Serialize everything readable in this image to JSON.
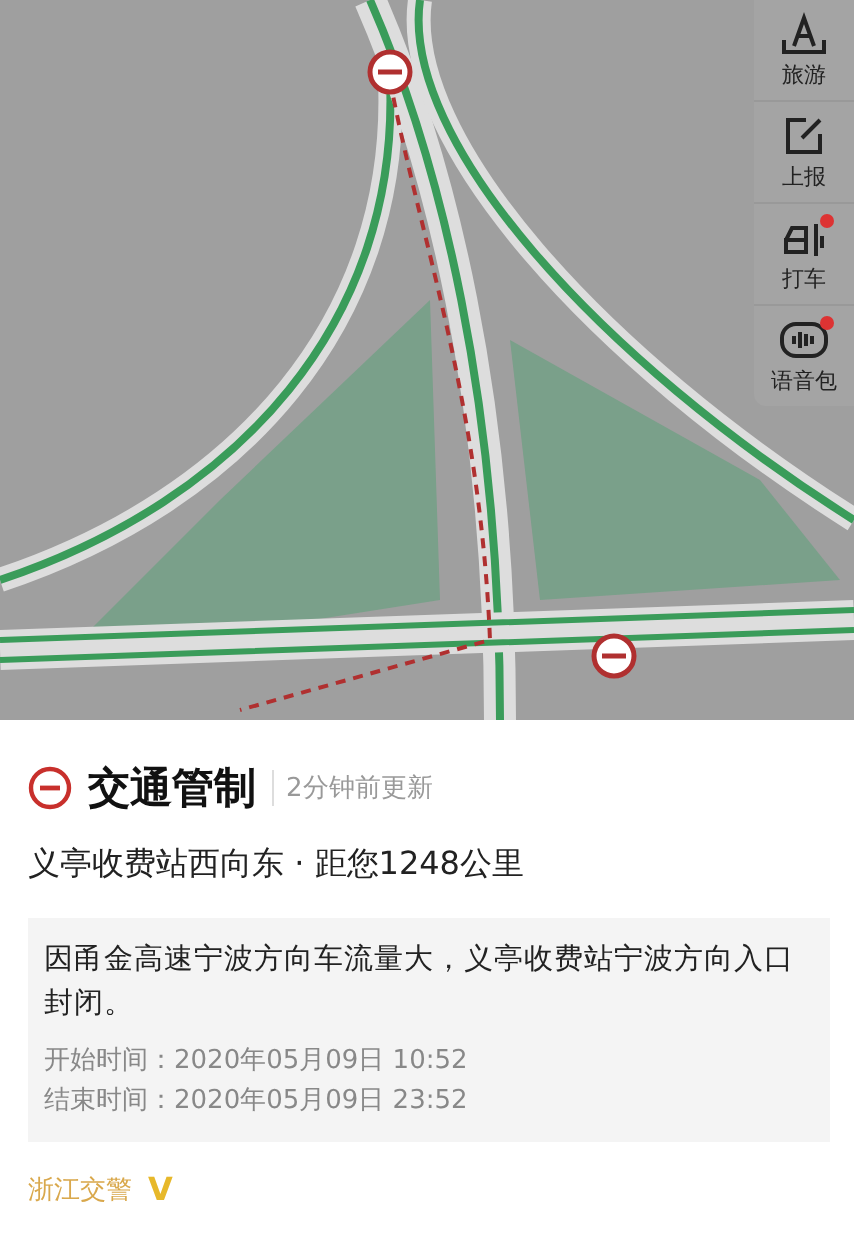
{
  "toolbar": [
    {
      "kind": "travel",
      "label": "旅游",
      "dot": false
    },
    {
      "kind": "report",
      "label": "上报",
      "dot": false
    },
    {
      "kind": "taxi",
      "label": "打车",
      "dot": true
    },
    {
      "kind": "voice",
      "label": "语音包",
      "dot": true
    }
  ],
  "card": {
    "title": "交通管制",
    "updated": "2分钟前更新",
    "location": "义亭收费站西向东 · 距您1248公里",
    "description": "因甬金高速宁波方向车流量大，义亭收费站宁波方向入口封闭。",
    "start": "开始时间：2020年05月09日 10:52",
    "end": "结束时间：2020年05月09日 23:52",
    "source": "浙江交警",
    "verified_mark": "V"
  }
}
